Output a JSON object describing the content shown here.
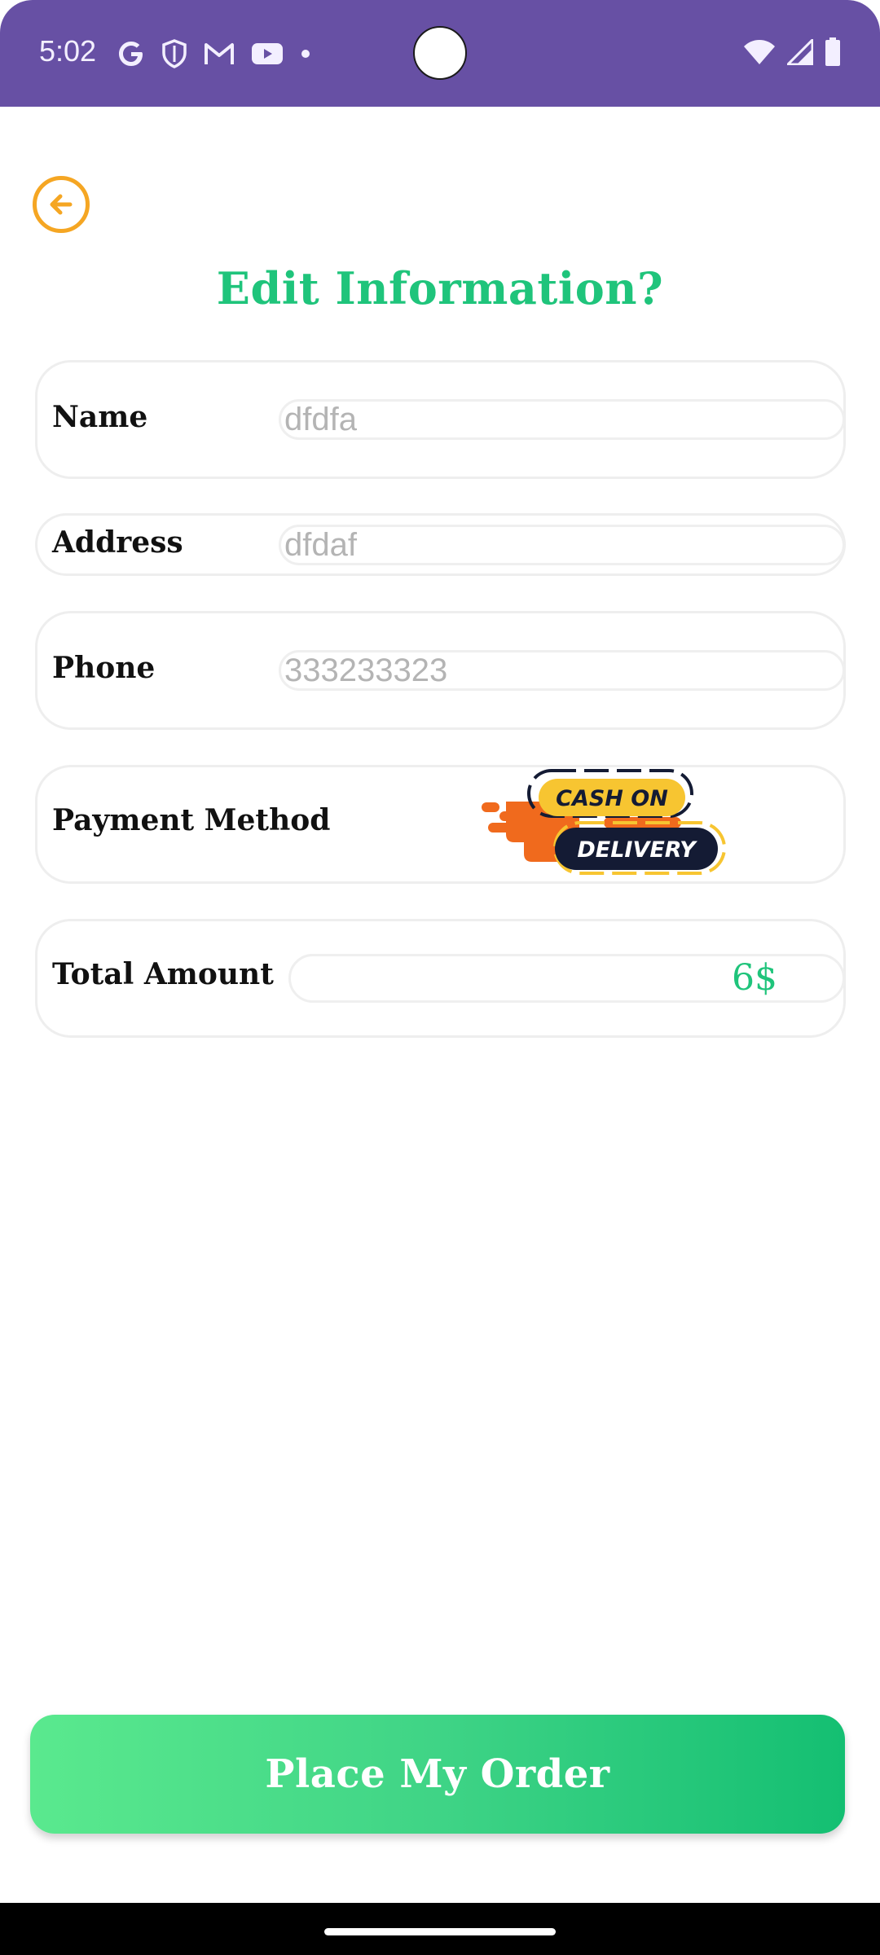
{
  "status_bar": {
    "time": "5:02",
    "notification_icons": [
      "google-icon",
      "shield-icon",
      "gmail-icon",
      "youtube-icon",
      "dot-icon"
    ],
    "system_icons": [
      "wifi-icon",
      "signal-icon",
      "battery-icon"
    ],
    "color": "#6750a4"
  },
  "header": {
    "back_icon": "arrow-left-circle-icon",
    "title": "Edit Information?"
  },
  "form": {
    "name": {
      "label": "Name",
      "value": "",
      "placeholder": "dfdfa"
    },
    "address": {
      "label": "Address",
      "value": "",
      "placeholder": "dfdaf"
    },
    "phone": {
      "label": "Phone",
      "value": "",
      "placeholder": "333233323"
    },
    "payment": {
      "label": "Payment Method",
      "badge_line1": "CASH ON",
      "badge_line2": "DELIVERY"
    },
    "total": {
      "label": "Total Amount",
      "value": "6$"
    }
  },
  "actions": {
    "order_label": "Place My Order"
  },
  "colors": {
    "accent_green": "#1fc47b",
    "back_orange": "#f5a623",
    "badge_yellow": "#f7c531",
    "badge_navy": "#141b34",
    "badge_orange": "#f06a1d"
  }
}
